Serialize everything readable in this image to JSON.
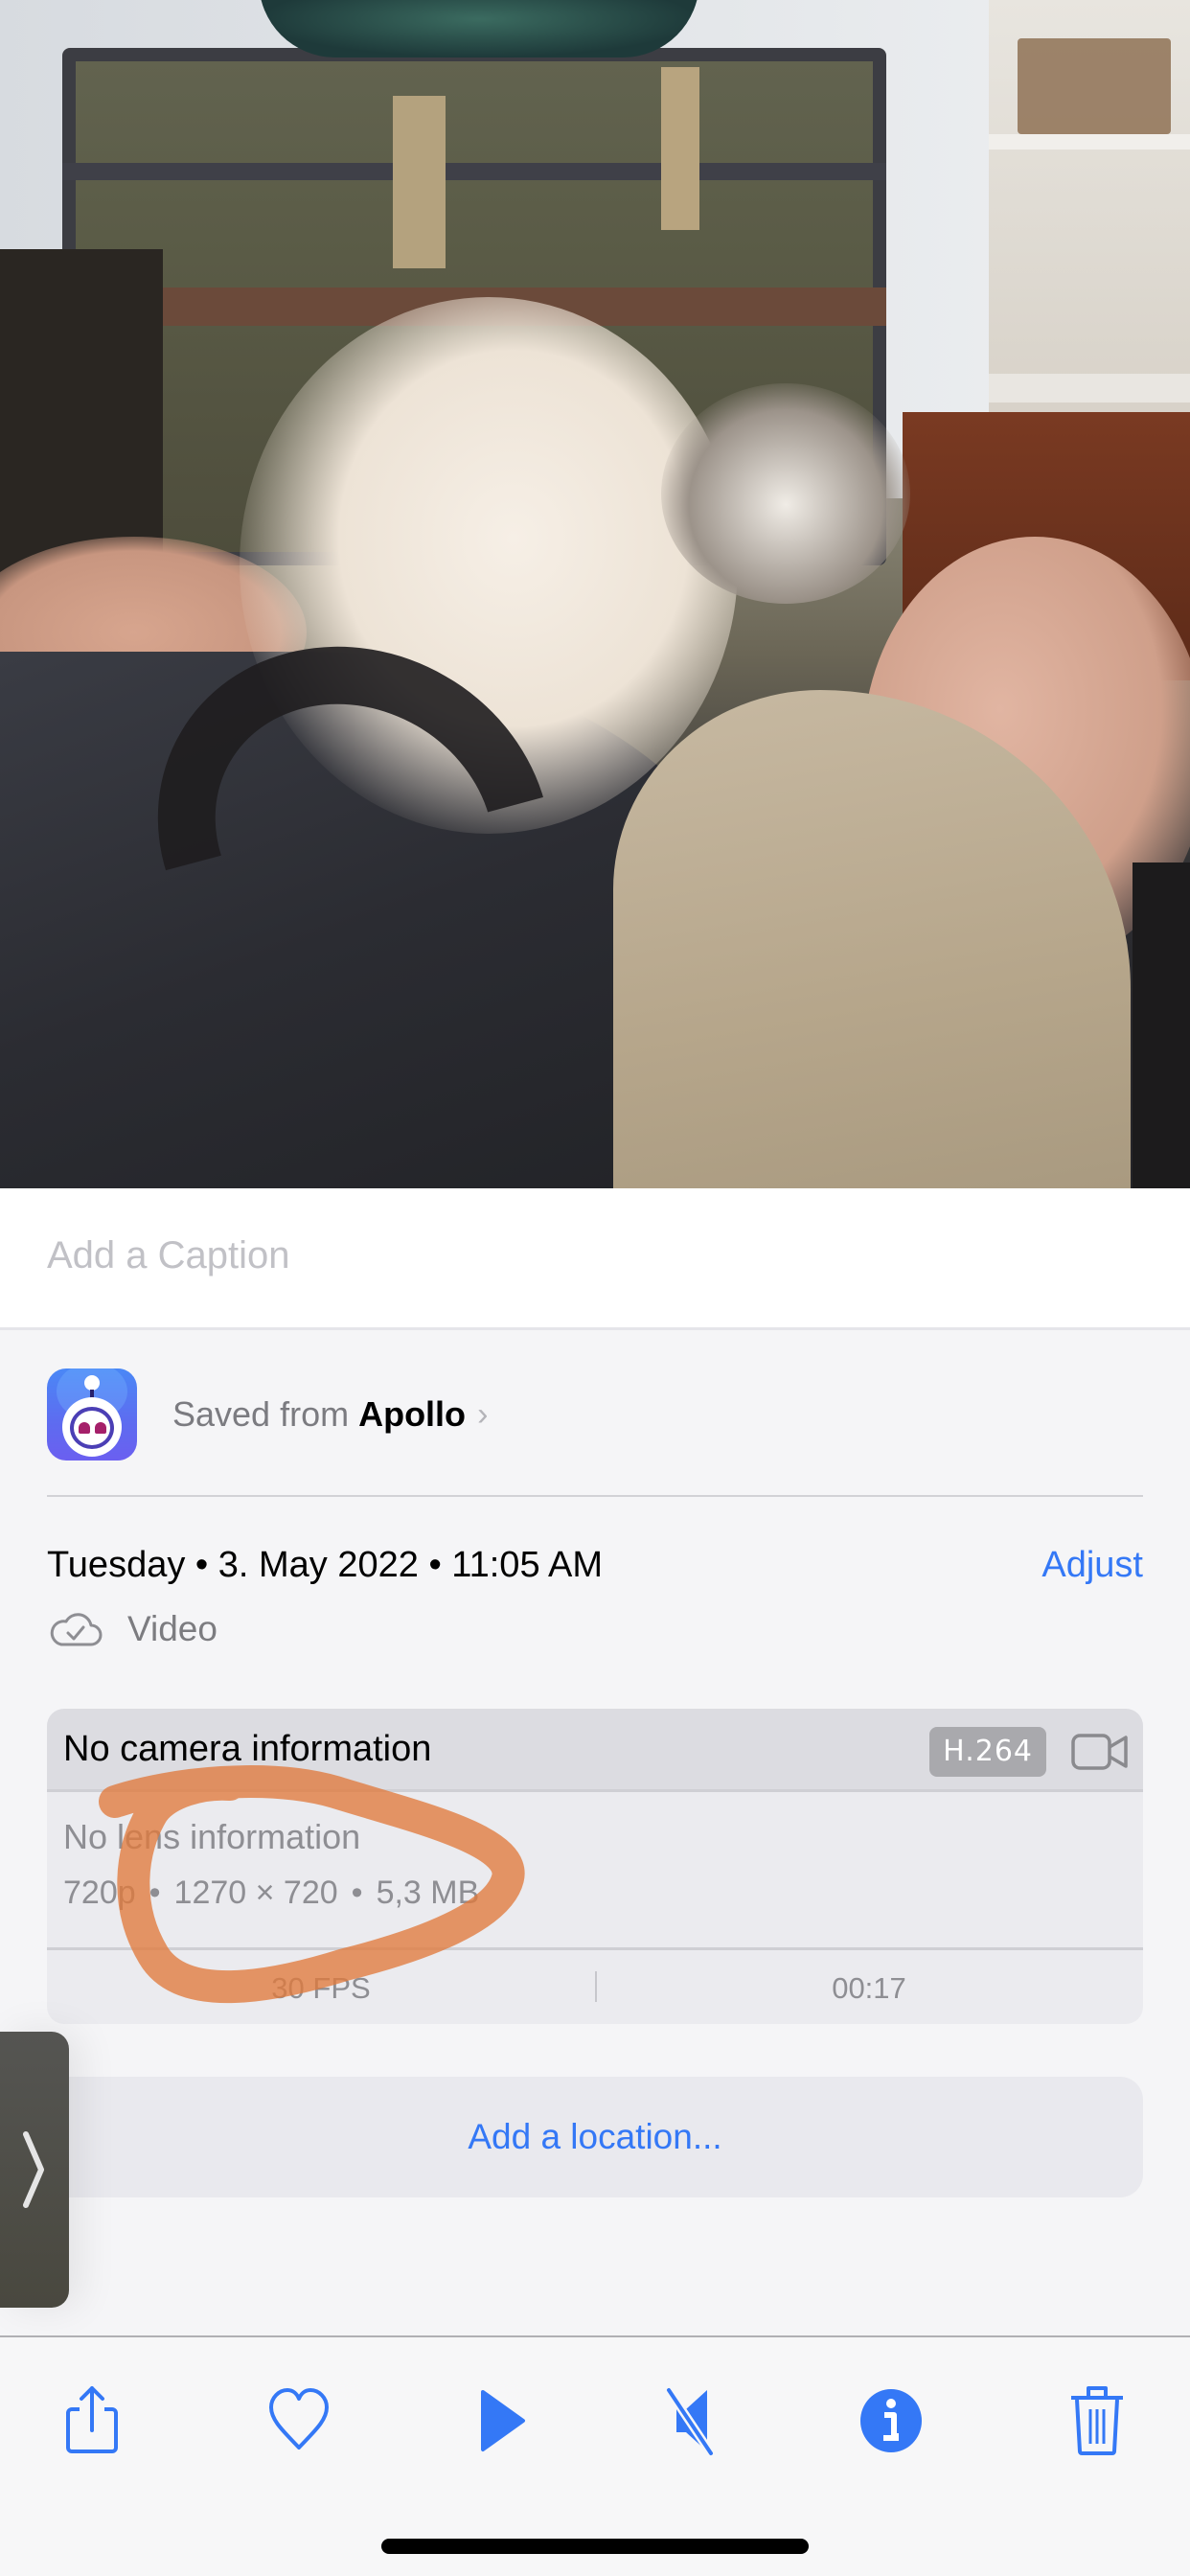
{
  "photo": {
    "description": "Video frame: a kitten lying on its back on a person's lap, playing, in front of a vintage trunk"
  },
  "caption": {
    "placeholder": "Add a Caption",
    "value": ""
  },
  "source": {
    "prefix": "Saved from",
    "app_name": "Apollo",
    "chevron": "›",
    "icon": "apollo-app-icon"
  },
  "metadata": {
    "date_text": "Tuesday • 3. May 2022 • 11:05 AM",
    "adjust_label": "Adjust",
    "media_type": "Video",
    "media_type_icon": "icloud-check-icon"
  },
  "info_card": {
    "camera": "No camera information",
    "codec": "H.264",
    "camera_icon": "video-camera-icon",
    "lens": "No lens information",
    "specs": {
      "quality": "720p",
      "resolution": "1270 × 720",
      "size": "5,3 MB",
      "separator": "•"
    },
    "fps": "30 FPS",
    "duration": "00:17"
  },
  "annotation": {
    "color": "#e07a3c",
    "shape": "hand-drawn loop circling lens info and specs"
  },
  "location": {
    "label": "Add a location..."
  },
  "side_handle": {
    "icon": "chevron-right-icon"
  },
  "toolbar": {
    "accent": "#3478f6",
    "items": [
      {
        "name": "share",
        "icon": "share-icon"
      },
      {
        "name": "favorite",
        "icon": "heart-icon"
      },
      {
        "name": "play",
        "icon": "play-icon"
      },
      {
        "name": "mute",
        "icon": "speaker-muted-icon"
      },
      {
        "name": "info",
        "icon": "info-icon"
      },
      {
        "name": "delete",
        "icon": "trash-icon"
      }
    ]
  }
}
